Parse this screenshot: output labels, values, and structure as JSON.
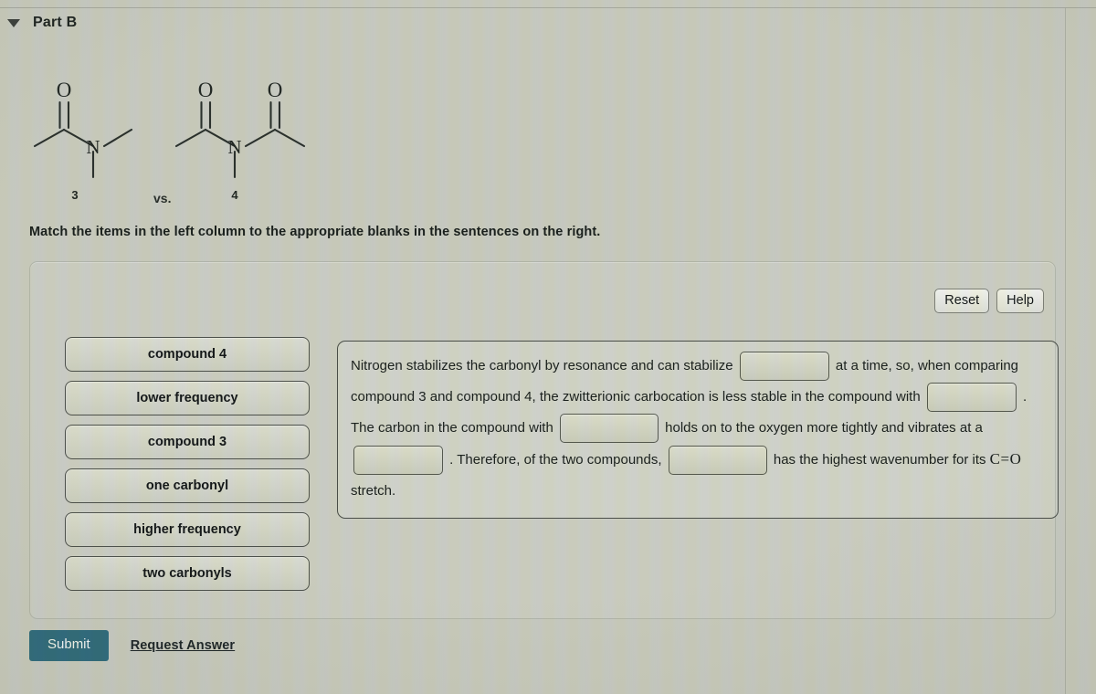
{
  "header": {
    "toggle_icon": "triangle-down-icon",
    "part_title": "Part B"
  },
  "figure": {
    "compound_left": {
      "label": "3",
      "atoms": [
        "O",
        "N"
      ],
      "description": "N,N-dimethylacetamide skeletal structure with one carbonyl"
    },
    "vs_label": "vs.",
    "compound_right": {
      "label": "4",
      "atoms": [
        "O",
        "O",
        "N"
      ],
      "description": "N-methyldiacetamide skeletal structure with two carbonyls"
    }
  },
  "instruction": "Match the items in the left column to the appropriate blanks in the sentences on the right.",
  "toolbar": {
    "reset_label": "Reset",
    "help_label": "Help"
  },
  "drag_items": [
    {
      "label": "compound 4"
    },
    {
      "label": "lower frequency"
    },
    {
      "label": "compound 3"
    },
    {
      "label": "one carbonyl"
    },
    {
      "label": "higher frequency"
    },
    {
      "label": "two carbonyls"
    }
  ],
  "sentence": {
    "segments": [
      {
        "type": "text",
        "value": "Nitrogen stabilizes the carbonyl by resonance and can stabilize"
      },
      {
        "type": "blank",
        "value": ""
      },
      {
        "type": "text",
        "value": "at a time, so, when comparing compound 3 and compound 4, the zwitterionic carbocation is less stable in the compound with"
      },
      {
        "type": "blank",
        "value": ""
      },
      {
        "type": "text",
        "value": ". The carbon in the compound with"
      },
      {
        "type": "blank",
        "value": ""
      },
      {
        "type": "text",
        "value": "holds on to the oxygen more tightly and vibrates at a"
      },
      {
        "type": "blank",
        "value": ""
      },
      {
        "type": "text",
        "value": ". Therefore, of the two compounds,"
      },
      {
        "type": "blank",
        "value": ""
      },
      {
        "type": "text",
        "value": "has the highest wavenumber for its"
      },
      {
        "type": "formula",
        "value": "C=O"
      },
      {
        "type": "text",
        "value": "stretch."
      }
    ]
  },
  "footer": {
    "submit_label": "Submit",
    "request_answer_label": "Request Answer"
  },
  "colors": {
    "submit_button": "#2e6a7c",
    "page_background": "#c9cbc2",
    "text": "#1b211e",
    "border": "#4a4e49"
  }
}
